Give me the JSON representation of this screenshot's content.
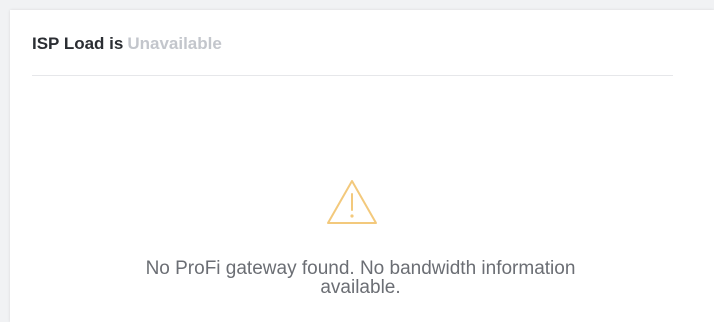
{
  "isp_load": {
    "title_prefix": "ISP Load is",
    "status": "Unavailable",
    "message_line1": "No ProFi gateway found. No bandwidth information",
    "message_line2": "available.",
    "icon": "warning-triangle-icon"
  },
  "colors": {
    "status_text": "#c3c6cc",
    "warning_icon": "#f3c97c",
    "message_text": "#6b6e74",
    "title_text": "#2b2e33"
  }
}
